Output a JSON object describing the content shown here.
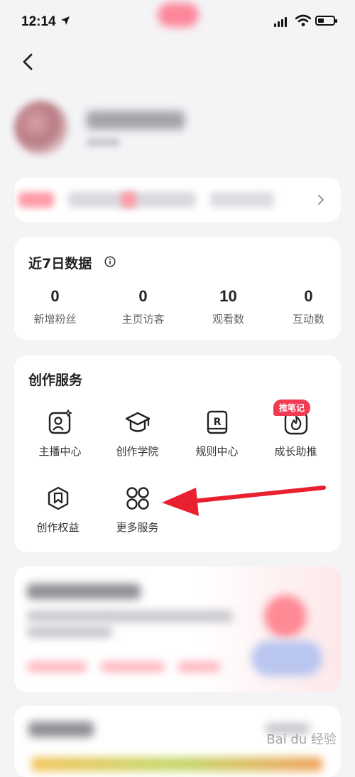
{
  "status_bar": {
    "time": "12:14",
    "location_icon": "location-arrow-icon"
  },
  "nav": {
    "back_icon": "chevron-left-icon"
  },
  "stats": {
    "title": "近7日数据",
    "items": [
      {
        "value": "0",
        "label": "新增粉丝"
      },
      {
        "value": "0",
        "label": "主页访客"
      },
      {
        "value": "10",
        "label": "观看数"
      },
      {
        "value": "0",
        "label": "互动数"
      }
    ]
  },
  "services": {
    "title": "创作服务",
    "badge": "推笔记",
    "items": [
      {
        "label": "主播中心",
        "icon": "anchor-center-icon"
      },
      {
        "label": "创作学院",
        "icon": "graduation-cap-icon"
      },
      {
        "label": "规则中心",
        "icon": "rule-book-icon"
      },
      {
        "label": "成长助推",
        "icon": "flame-icon"
      },
      {
        "label": "创作权益",
        "icon": "shield-bookmark-icon"
      },
      {
        "label": "更多服务",
        "icon": "grid-circles-icon"
      }
    ]
  },
  "watermark": "Bai du 经验",
  "colors": {
    "accent": "#f23a52",
    "arrow": "#e8202f",
    "background": "#f4f4f6"
  }
}
